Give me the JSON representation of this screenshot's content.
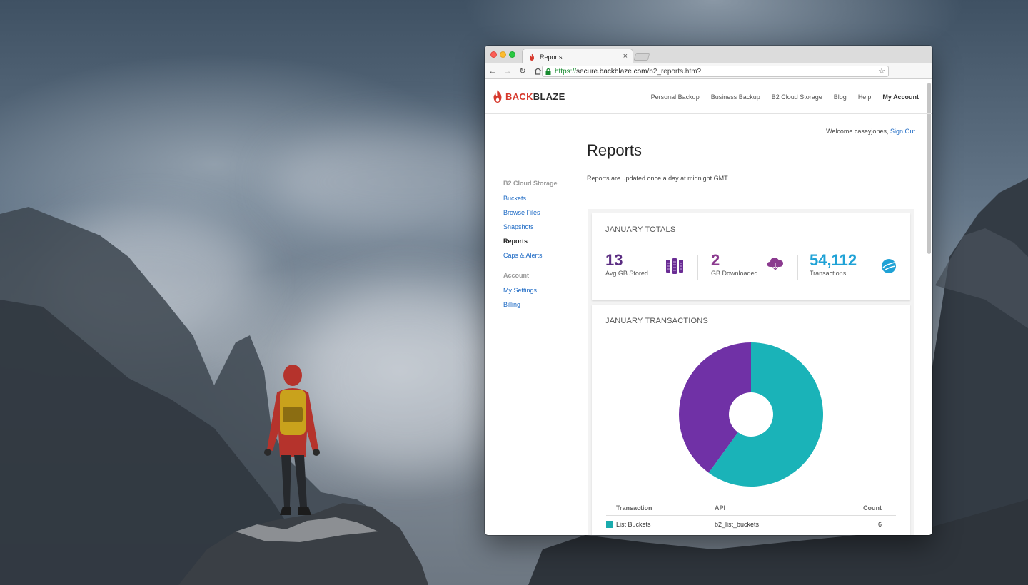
{
  "browser": {
    "tab_title": "Reports",
    "url_secure": "https://",
    "url_domain": "secure.backblaze.com",
    "url_path": "/b2_reports.htm?"
  },
  "site": {
    "logo_part1": "BACK",
    "logo_part2": "BLAZE",
    "nav": [
      {
        "label": "Personal Backup"
      },
      {
        "label": "Business Backup"
      },
      {
        "label": "B2 Cloud Storage"
      },
      {
        "label": "Blog"
      },
      {
        "label": "Help"
      },
      {
        "label": "My Account"
      }
    ],
    "welcome_text": "Welcome caseyjones,",
    "sign_out": "Sign Out"
  },
  "sidebar": {
    "section1": "B2 Cloud Storage",
    "items1": [
      {
        "label": "Buckets"
      },
      {
        "label": "Browse Files"
      },
      {
        "label": "Snapshots"
      },
      {
        "label": "Reports"
      },
      {
        "label": "Caps & Alerts"
      }
    ],
    "section2": "Account",
    "items2": [
      {
        "label": "My Settings"
      },
      {
        "label": "Billing"
      }
    ]
  },
  "main": {
    "title": "Reports",
    "subtitle": "Reports are updated once a day at midnight GMT.",
    "totals": {
      "title": "JANUARY TOTALS",
      "stats": [
        {
          "value": "13",
          "label": "Avg GB Stored",
          "color": "#5b2d82"
        },
        {
          "value": "2",
          "label": "GB Downloaded",
          "color": "#8b3a8f"
        },
        {
          "value": "54,112",
          "label": "Transactions",
          "color": "#1fa2d6"
        }
      ]
    },
    "transactions": {
      "title": "JANUARY TRANSACTIONS",
      "table": {
        "headers": [
          "Transaction",
          "API",
          "Count"
        ],
        "rows": [
          {
            "name": "List Buckets",
            "api": "b2_list_buckets",
            "count": "6",
            "color": "#1aabad"
          }
        ]
      }
    }
  },
  "chart_data": {
    "type": "pie",
    "title": "",
    "slices": [
      {
        "label": "List Buckets",
        "value": 60,
        "color": "#1ab3b8"
      },
      {
        "label": "",
        "value": 40,
        "color": "#7031a6"
      }
    ],
    "donut": true
  }
}
